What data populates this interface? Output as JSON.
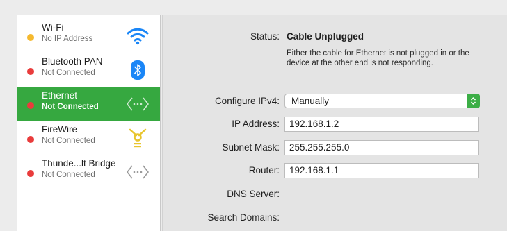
{
  "sidebar": {
    "services": [
      {
        "name": "Wi-Fi",
        "status": "No IP Address",
        "dot_color": "#f5b92f",
        "icon": "wifi-icon",
        "selected": false
      },
      {
        "name": "Bluetooth PAN",
        "status": "Not Connected",
        "dot_color": "#e93c3c",
        "icon": "bluetooth-icon",
        "selected": false
      },
      {
        "name": "Ethernet",
        "status": "Not Connected",
        "dot_color": "#e93c3c",
        "icon": "ethernet-icon",
        "selected": true
      },
      {
        "name": "FireWire",
        "status": "Not Connected",
        "dot_color": "#e93c3c",
        "icon": "firewire-icon",
        "selected": false
      },
      {
        "name": "Thunde...lt Bridge",
        "status": "Not Connected",
        "dot_color": "#e93c3c",
        "icon": "thunderbolt-bridge-icon",
        "selected": false
      }
    ]
  },
  "main": {
    "status_label": "Status:",
    "status_value": "Cable Unplugged",
    "status_description": "Either the cable for Ethernet is not plugged in or the device at the other end is not responding.",
    "configure_label": "Configure IPv4:",
    "configure_value": "Manually",
    "ip_label": "IP Address:",
    "ip_value": "192.168.1.2",
    "subnet_label": "Subnet Mask:",
    "subnet_value": "255.255.255.0",
    "router_label": "Router:",
    "router_value": "192.168.1.1",
    "dns_label": "DNS Server:",
    "search_domains_label": "Search Domains:"
  },
  "colors": {
    "selected_row": "#36a840",
    "accent_stepper": "#3cae46",
    "wifi_blue": "#1a86f7",
    "bluetooth_blue": "#1a86f7"
  }
}
